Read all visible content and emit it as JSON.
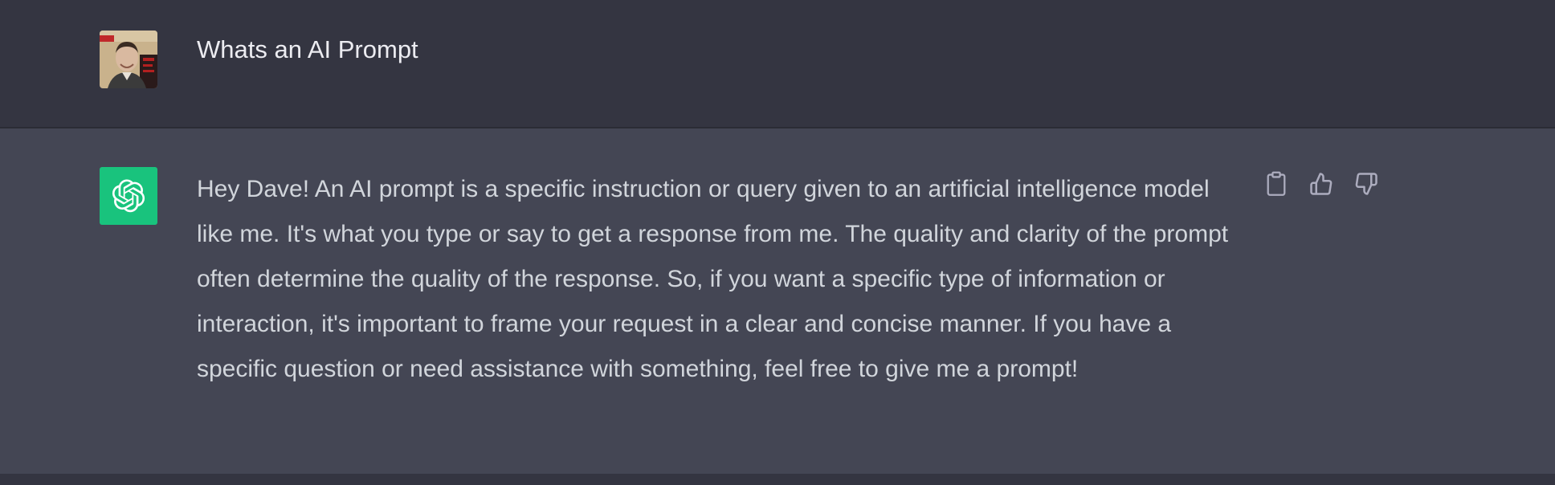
{
  "conversation": {
    "user_message": "Whats an AI Prompt",
    "assistant_message": "Hey Dave! An AI prompt is a specific instruction or query given to an artificial intelligence model like me. It's what you type or say to get a response from me. The quality and clarity of the prompt often determine the quality of the response. So, if you want a specific type of information or interaction, it's important to frame your request in a clear and concise manner. If you have a specific question or need assistance with something, feel free to give me a prompt!"
  },
  "icons": {
    "user_avatar": "user-photo-avatar",
    "assistant_avatar": "openai-logo-icon",
    "copy": "clipboard-icon",
    "like": "thumbs-up-icon",
    "dislike": "thumbs-down-icon"
  },
  "colors": {
    "user_bg": "#343541",
    "assistant_bg": "#444654",
    "assistant_avatar_bg": "#19c37d",
    "text_primary": "#ececf1",
    "text_secondary": "#d1d5db",
    "icon_color": "#acacbe"
  }
}
